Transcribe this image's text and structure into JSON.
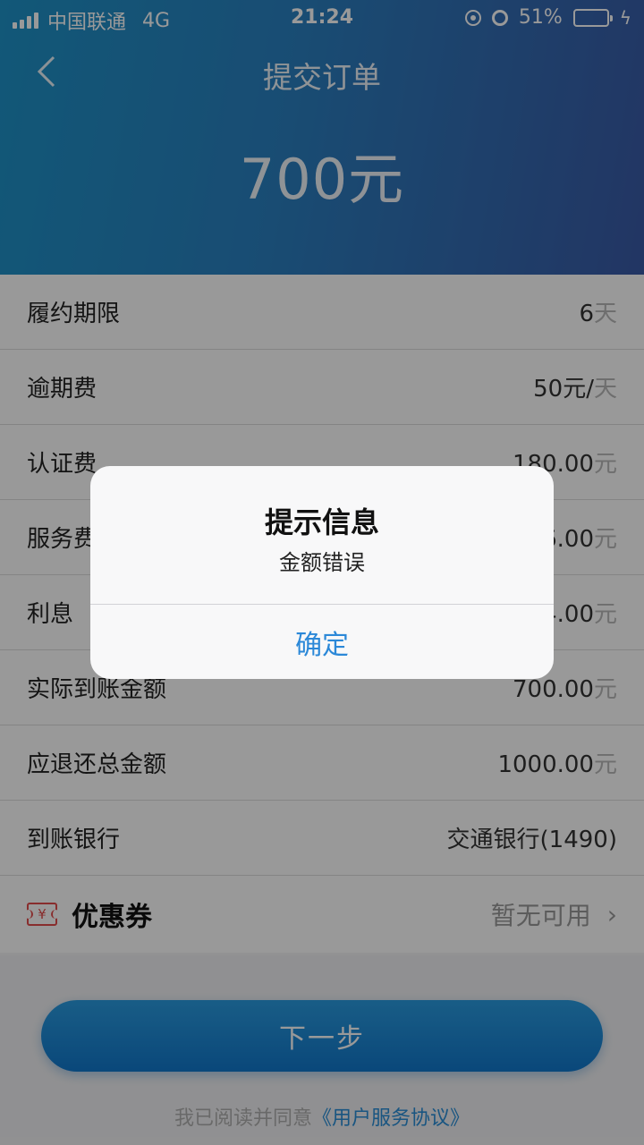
{
  "status_bar": {
    "carrier": "中国联通",
    "network": "4G",
    "time": "21:24",
    "battery": "51%",
    "battery_level": 0.51
  },
  "header": {
    "title": "提交订单",
    "amount": "700元"
  },
  "rows": [
    {
      "label": "履约期限",
      "value": "6",
      "unit": "天"
    },
    {
      "label": "逾期费",
      "value": "50元/",
      "unit": "天"
    },
    {
      "label": "认证费",
      "value": "180.00",
      "unit": "元"
    },
    {
      "label": "服务费",
      "value": "6.00",
      "unit": "元"
    },
    {
      "label": "利息",
      "value": "4.00",
      "unit": "元"
    },
    {
      "label": "实际到账金额",
      "value": "700.00",
      "unit": "元"
    },
    {
      "label": "应退还总金额",
      "value": "1000.00",
      "unit": "元"
    },
    {
      "label": "到账银行",
      "value": "交通银行(1490)",
      "unit": ""
    }
  ],
  "coupon": {
    "icon_text": "¥",
    "label": "优惠券",
    "value": "暂无可用"
  },
  "next_button": "下一步",
  "agreement": {
    "prefix": "我已阅读并同意",
    "link": "《用户服务协议》"
  },
  "dialog": {
    "title": "提示信息",
    "message": "金额错误",
    "confirm": "确定"
  },
  "colors": {
    "accent": "#2b88d8",
    "header_start": "#1e93c8",
    "header_end": "#3a5aa6",
    "coupon_icon": "#e34b4b"
  }
}
